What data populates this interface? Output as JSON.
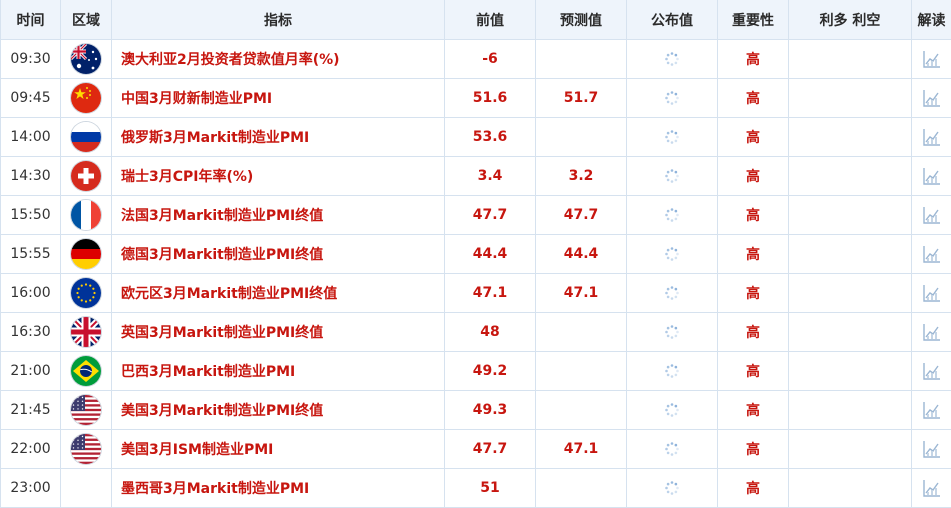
{
  "headers": {
    "time": "时间",
    "region": "区域",
    "indicator": "指标",
    "previous": "前值",
    "forecast": "预测值",
    "actual": "公布值",
    "importance": "重要性",
    "impact": "利多 利空",
    "interpret": "解读"
  },
  "icons": {
    "loading": "loading-spinner-icon",
    "chart": "chart-analysis-icon"
  },
  "colors": {
    "value_red": "#c7160f",
    "header_bg": "#eef4fb",
    "border": "#d6e2ef"
  },
  "rows": [
    {
      "time": "09:30",
      "flag": "australia",
      "indicator": "澳大利亚2月投资者贷款值月率(%)",
      "previous": "-6",
      "forecast": "",
      "actual": "",
      "importance": "高",
      "impact": ""
    },
    {
      "time": "09:45",
      "flag": "china",
      "indicator": "中国3月财新制造业PMI",
      "previous": "51.6",
      "forecast": "51.7",
      "actual": "",
      "importance": "高",
      "impact": ""
    },
    {
      "time": "14:00",
      "flag": "russia",
      "indicator": "俄罗斯3月Markit制造业PMI",
      "previous": "53.6",
      "forecast": "",
      "actual": "",
      "importance": "高",
      "impact": ""
    },
    {
      "time": "14:30",
      "flag": "switzerland",
      "indicator": "瑞士3月CPI年率(%)",
      "previous": "3.4",
      "forecast": "3.2",
      "actual": "",
      "importance": "高",
      "impact": ""
    },
    {
      "time": "15:50",
      "flag": "france",
      "indicator": "法国3月Markit制造业PMI终值",
      "previous": "47.7",
      "forecast": "47.7",
      "actual": "",
      "importance": "高",
      "impact": ""
    },
    {
      "time": "15:55",
      "flag": "germany",
      "indicator": "德国3月Markit制造业PMI终值",
      "previous": "44.4",
      "forecast": "44.4",
      "actual": "",
      "importance": "高",
      "impact": ""
    },
    {
      "time": "16:00",
      "flag": "eu",
      "indicator": "欧元区3月Markit制造业PMI终值",
      "previous": "47.1",
      "forecast": "47.1",
      "actual": "",
      "importance": "高",
      "impact": ""
    },
    {
      "time": "16:30",
      "flag": "uk",
      "indicator": "英国3月Markit制造业PMI终值",
      "previous": "48",
      "forecast": "",
      "actual": "",
      "importance": "高",
      "impact": ""
    },
    {
      "time": "21:00",
      "flag": "brazil",
      "indicator": "巴西3月Markit制造业PMI",
      "previous": "49.2",
      "forecast": "",
      "actual": "",
      "importance": "高",
      "impact": ""
    },
    {
      "time": "21:45",
      "flag": "usa",
      "indicator": "美国3月Markit制造业PMI终值",
      "previous": "49.3",
      "forecast": "",
      "actual": "",
      "importance": "高",
      "impact": ""
    },
    {
      "time": "22:00",
      "flag": "usa",
      "indicator": "美国3月ISM制造业PMI",
      "previous": "47.7",
      "forecast": "47.1",
      "actual": "",
      "importance": "高",
      "impact": ""
    },
    {
      "time": "23:00",
      "flag": "",
      "indicator": "墨西哥3月Markit制造业PMI",
      "previous": "51",
      "forecast": "",
      "actual": "",
      "importance": "高",
      "impact": ""
    }
  ]
}
